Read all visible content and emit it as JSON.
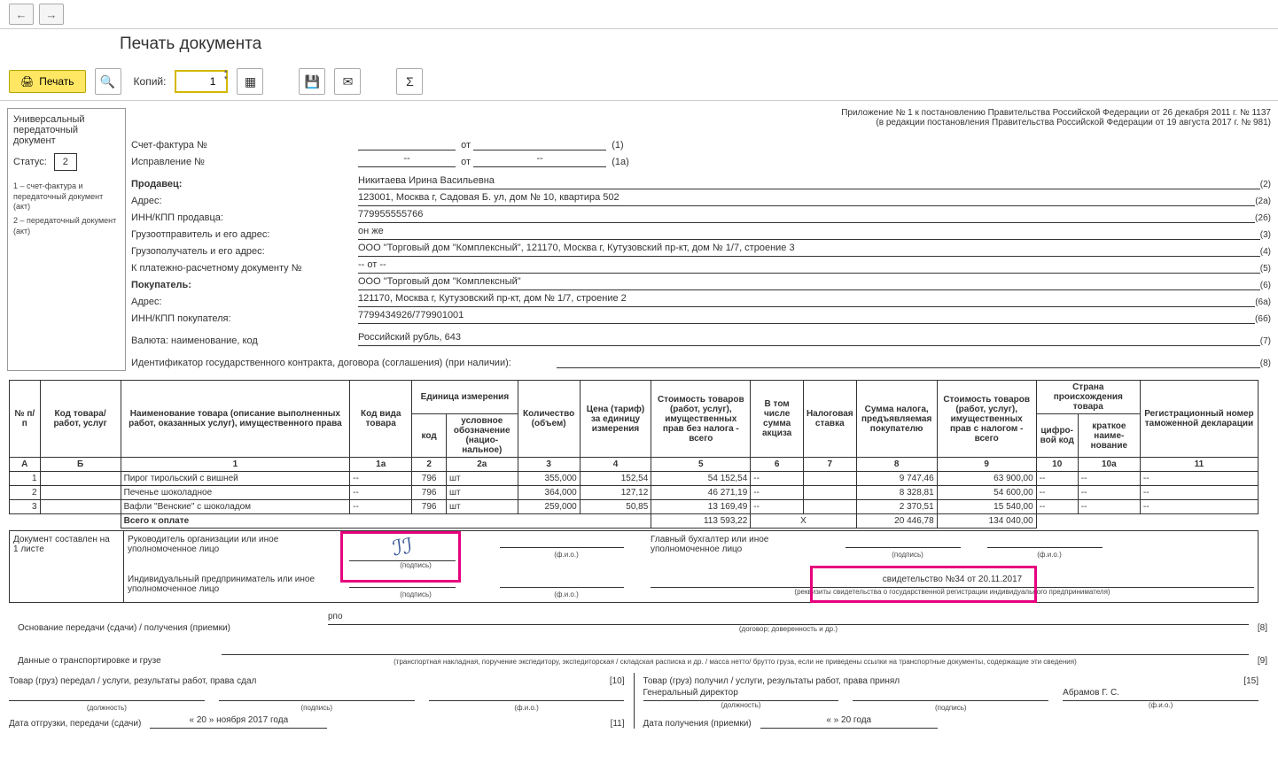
{
  "title": "Печать документа",
  "toolbar": {
    "print": "Печать",
    "copies_label": "Копий:",
    "copies_value": "1"
  },
  "left": {
    "title": "Универсальный передаточный документ",
    "status_label": "Статус:",
    "status": "2",
    "legend1": "1 – счет-фактура и передаточный документ (акт)",
    "legend2": "2 – передаточный документ (акт)"
  },
  "app_note1": "Приложение № 1 к постановлению Правительства Российской Федерации от 26 декабря 2011 г. № 1137",
  "app_note2": "(в редакции постановления Правительства Российской Федерации от 19 августа 2017 г. № 981)",
  "header": {
    "invoice_label": "Счет-фактура №",
    "invoice_from": "от",
    "invoice_ref": "(1)",
    "corr_label": "Исправление №",
    "corr_val": "--",
    "corr_from": "от",
    "corr_from_val": "--",
    "corr_ref": "(1а)",
    "seller_label": "Продавец:",
    "seller": "Никитаева Ирина Васильевна",
    "seller_ref": "(2)",
    "addr_label": "Адрес:",
    "addr": "123001, Москва г, Садовая Б. ул, дом № 10, квартира 502",
    "addr_ref": "(2а)",
    "inn_label": "ИНН/КПП продавца:",
    "inn": "779955555766",
    "inn_ref": "(2б)",
    "shipper_label": "Грузоотправитель и его адрес:",
    "shipper": "он же",
    "shipper_ref": "(3)",
    "consignee_label": "Грузополучатель и его адрес:",
    "consignee": "ООО \"Торговый дом \"Комплексный\", 121170, Москва г, Кутузовский пр-кт, дом № 1/7, строение 3",
    "consignee_ref": "(4)",
    "paydoc_label": "К платежно-расчетному документу №",
    "paydoc": "-- от --",
    "paydoc_ref": "(5)",
    "buyer_label": "Покупатель:",
    "buyer": "ООО \"Торговый дом \"Комплексный\"",
    "buyer_ref": "(6)",
    "baddr_label": "Адрес:",
    "baddr": "121170, Москва г, Кутузовский пр-кт, дом № 1/7, строение 2",
    "baddr_ref": "(6а)",
    "binn_label": "ИНН/КПП покупателя:",
    "binn": "7799434926/779901001",
    "binn_ref": "(6б)",
    "currency_label": "Валюта: наименование, код",
    "currency": "Российский рубль, 643",
    "currency_ref": "(7)",
    "contract_label": "Идентификатор государственного контракта, договора (соглашения) (при наличии):",
    "contract_ref": "(8)"
  },
  "cols": {
    "num": "№ п/п",
    "code": "Код товара/ работ, услуг",
    "name": "Наименование товара (описание выполненных работ, оказанных услуг), имущественного права",
    "kind": "Код вида товара",
    "unit": "Единица измерения",
    "unit_code": "код",
    "unit_name": "условное обозначе­ние (нацио­нальное)",
    "qty": "Коли­чество (объем)",
    "price": "Цена (тариф) за единицу измерения",
    "sum_no_tax": "Стоимость товаров (работ, услуг), имущест­венных прав без налога - всего",
    "excise": "В том числе сумма акциза",
    "rate": "Нало­говая ставка",
    "tax": "Сумма налога, предъяв­ляемая покупателю",
    "sum_tax": "Стоимость товаров (работ, услуг), имущест­венных прав с налогом - всего",
    "country": "Страна происхождения товара",
    "c_code": "циф­ро­вой код",
    "c_name": "краткое наиме­нование",
    "decl": "Регистрационный номер таможенной декларации",
    "hA": "А",
    "hB": "Б",
    "h1": "1",
    "h1a": "1а",
    "h2": "2",
    "h2a": "2а",
    "h3": "3",
    "h4": "4",
    "h5": "5",
    "h6": "6",
    "h7": "7",
    "h8": "8",
    "h9": "9",
    "h10": "10",
    "h10a": "10а",
    "h11": "11"
  },
  "rows": [
    {
      "n": "1",
      "name": "Пирог тирольский с вишней",
      "kind": "--",
      "ucode": "796",
      "uname": "шт",
      "qty": "355,000",
      "price": "152,54",
      "sum": "54 152,54",
      "excise": "--",
      "rate": "",
      "tax": "9 747,46",
      "total": "63 900,00",
      "cc": "--",
      "cn": "--",
      "decl": "--"
    },
    {
      "n": "2",
      "name": "Печенье шоколадное",
      "kind": "--",
      "ucode": "796",
      "uname": "шт",
      "qty": "364,000",
      "price": "127,12",
      "sum": "46 271,19",
      "excise": "--",
      "rate": "",
      "tax": "8 328,81",
      "total": "54 600,00",
      "cc": "--",
      "cn": "--",
      "decl": "--"
    },
    {
      "n": "3",
      "name": "Вафли \"Венские\" с шоколадом",
      "kind": "--",
      "ucode": "796",
      "uname": "шт",
      "qty": "259,000",
      "price": "50,85",
      "sum": "13 169,49",
      "excise": "--",
      "rate": "",
      "tax": "2 370,51",
      "total": "15 540,00",
      "cc": "--",
      "cn": "--",
      "decl": "--"
    }
  ],
  "totals": {
    "label": "Всего к оплате",
    "sum": "113 593,22",
    "excise": "Х",
    "tax": "20 446,78",
    "total": "134 040,00"
  },
  "footer": {
    "doc_compiled": "Документ составлен на",
    "sheets": "1 листе",
    "head": "Руководитель организации или иное уполномоченное лицо",
    "accountant": "Главный бухгалтер или иное уполномоченное лицо",
    "ip": "Индивидуальный предприниматель или иное уполномоченное лицо",
    "cert": "свидетельство №34 от 20.11.2017",
    "sig": "(подпись)",
    "fio": "(ф.и.о.)",
    "req": "(реквизиты свидетельства о государственной регистрации индивидуального предпринимателя)",
    "basis_label": "Основание передачи (сдачи) / получения (приемки)",
    "basis_val": "рпо",
    "basis_cap": "(договор; доверенность и др.)",
    "basis_ref": "[8]",
    "trans_label": "Данные о транспортировке и грузе",
    "trans_cap": "(транспортная накладная, поручение экспедитору, экспедиторская / складская расписка и др. / масса нетто/ брутто груза, если не приведены ссылки на транспортные документы, содержащие эти сведения)",
    "trans_ref": "[9]",
    "handed": "Товар (груз) передал / услуги, результаты работ, права сдал",
    "handed_ref": "[10]",
    "received": "Товар (груз) получил / услуги, результаты работ, права принял",
    "received_ref": "[15]",
    "position": "(должность)",
    "director": "Генеральный директор",
    "director_name": "Абрамов Г. С.",
    "ship_date_label": "Дата отгрузки, передачи (сдачи)",
    "ship_date": "« 20 »   ноября   2017  года",
    "ship_ref": "[11]",
    "recv_date_label": "Дата получения (приемки)",
    "recv_date": "«       »                    20        года"
  }
}
